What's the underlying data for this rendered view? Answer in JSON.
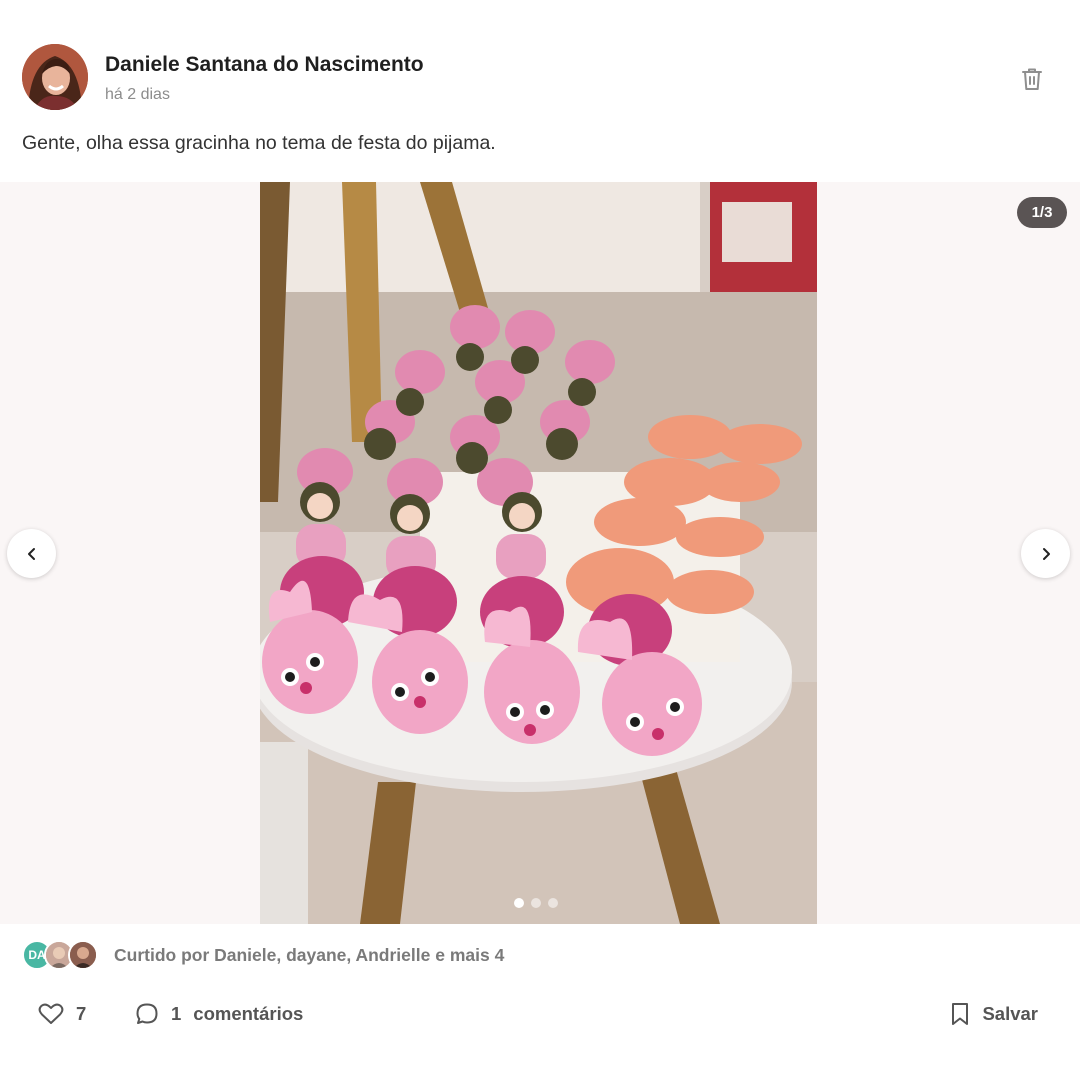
{
  "post": {
    "author": "Daniele Santana do Nascimento",
    "timestamp": "há 2 dias",
    "caption": "Gente, olha essa gracinha no tema de festa do pijama.",
    "avatar_icon": "user-avatar-photo",
    "delete_icon": "trash-icon"
  },
  "carousel": {
    "counter": "1/3",
    "current_slide": 1,
    "total_slides": 3,
    "prev_icon": "chevron-left-icon",
    "next_icon": "chevron-right-icon",
    "image_content": "pajama-party-sweets-photo"
  },
  "likes": {
    "text": "Curtido por Daniele, dayane, Andrielle e mais 4",
    "first_liker_initials": "DA",
    "liker_avatar_color": "#49b7a3"
  },
  "actions": {
    "like_count": "7",
    "comment_count": "1",
    "comment_label": "comentários",
    "save_label": "Salvar"
  },
  "colors": {
    "text_primary": "#1f1f1f",
    "text_muted": "#8c8c8c",
    "badge_bg": "#5a5454",
    "carousel_bg": "#faf6f6",
    "accent_pink": "#e58fb7"
  }
}
